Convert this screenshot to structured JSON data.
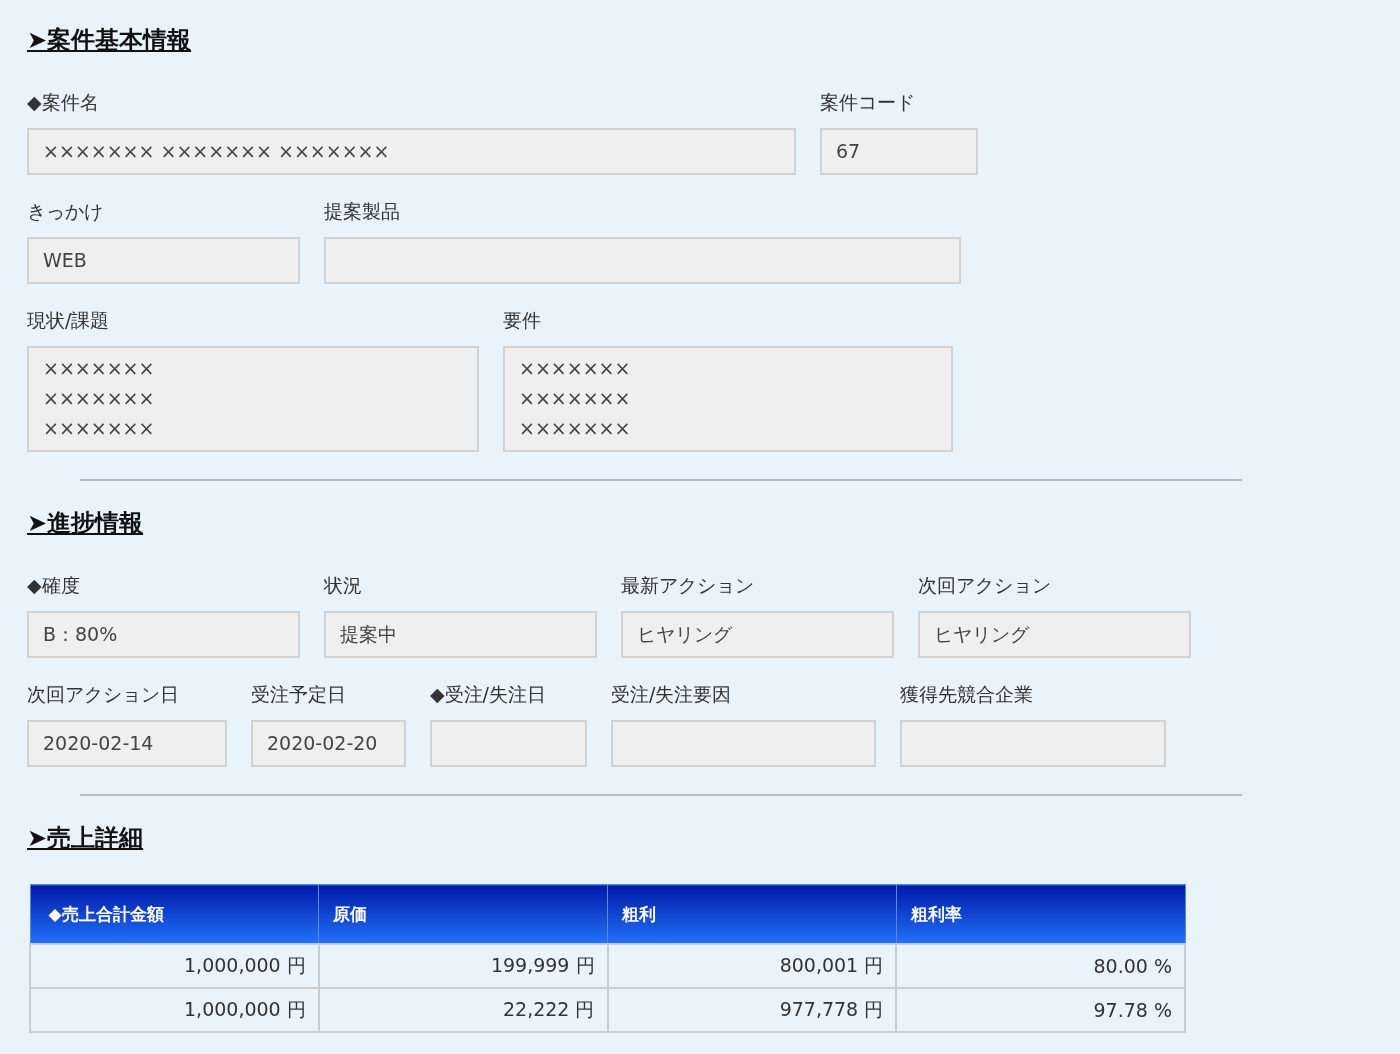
{
  "sections": [
    {
      "heading": "➤案件基本情報",
      "field_groups": [
        [
          {
            "label": "◆案件名",
            "value": "××××××× ××××××× ×××××××",
            "kind": "input"
          },
          {
            "label": "案件コード",
            "value": "67",
            "kind": "input"
          }
        ],
        [
          {
            "label": "きっかけ",
            "value": "WEB",
            "kind": "input"
          },
          {
            "label": "提案製品",
            "kind": "input"
          }
        ],
        [
          {
            "label": "現状/課題",
            "lines": [
              "×××××××",
              "×××××××",
              "×××××××"
            ],
            "kind": "textarea"
          },
          {
            "label": "要件",
            "lines": [
              "×××××××",
              "×××××××",
              "×××××××"
            ],
            "kind": "textarea"
          }
        ]
      ]
    },
    {
      "heading": "➤進捗情報",
      "field_groups": [
        [
          {
            "label": "◆確度",
            "value": "B：80%",
            "kind": "input"
          },
          {
            "label": "状況",
            "value": "提案中",
            "kind": "input"
          },
          {
            "label": "最新アクション",
            "value": "ヒヤリング",
            "kind": "input"
          },
          {
            "label": "次回アクション",
            "value": "ヒヤリング",
            "kind": "input"
          }
        ],
        [
          {
            "label": "次回アクション日",
            "value": "2020-02-14",
            "kind": "input"
          },
          {
            "label": "受注予定日",
            "value": "2020-02-20",
            "kind": "input"
          },
          {
            "label": "◆受注/失注日",
            "kind": "input"
          },
          {
            "label": "受注/失注要因",
            "kind": "input"
          },
          {
            "label": "獲得先競合企業",
            "kind": "input"
          }
        ]
      ]
    },
    {
      "heading": "➤売上詳細",
      "table": {
        "columns": [
          "◆売上合計金額",
          "原価",
          "粗利",
          "粗利率"
        ],
        "rows": [
          [
            "1,000,000 円",
            "199,999 円",
            "800,001 円",
            "80.00 %"
          ],
          [
            "1,000,000 円",
            "22,222 円",
            "977,778 円",
            "97.78 %"
          ]
        ]
      }
    }
  ]
}
